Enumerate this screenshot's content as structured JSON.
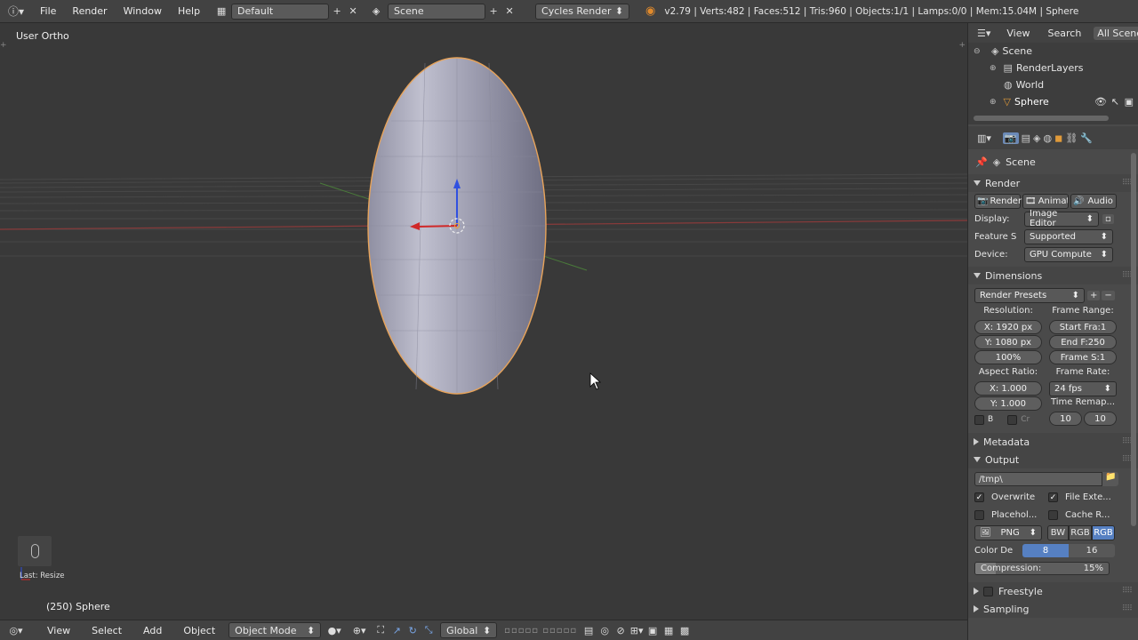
{
  "topbar": {
    "menus": [
      "File",
      "Render",
      "Window",
      "Help"
    ],
    "layout": "Default",
    "scene": "Scene",
    "engine": "Cycles Render",
    "stats": "v2.79 | Verts:482 | Faces:512 | Tris:960 | Objects:1/1 | Lamps:0/0 | Mem:15.04M | Sphere"
  },
  "viewport": {
    "view_label": "User Ortho",
    "last_op": "Last: Resize",
    "object_label": "(250) Sphere"
  },
  "outliner": {
    "view": "View",
    "search": "Search",
    "filter": "All Scenes",
    "items": [
      "Scene",
      "RenderLayers",
      "World",
      "Sphere"
    ]
  },
  "props": {
    "context": "Scene",
    "render": {
      "title": "Render",
      "tabs": [
        "Render",
        "Animati",
        "Audio"
      ],
      "display_label": "Display:",
      "display_value": "Image Editor",
      "feature_label": "Feature S",
      "feature_value": "Supported",
      "device_label": "Device:",
      "device_value": "GPU Compute"
    },
    "dimensions": {
      "title": "Dimensions",
      "presets": "Render Presets",
      "resolution_label": "Resolution:",
      "res_x": "X: 1920 px",
      "res_y": "Y: 1080 px",
      "res_pct": "100%",
      "frame_range_label": "Frame Range:",
      "start": "Start Fra:1",
      "end": "End F:250",
      "step": "Frame S:1",
      "aspect_label": "Aspect Ratio:",
      "asp_x": "X:    1.000",
      "asp_y": "Y:    1.000",
      "framerate_label": "Frame Rate:",
      "fps": "24 fps",
      "remap_label": "Time Remap...",
      "remap_old": "10",
      "remap_new": "10",
      "border": "B",
      "crop": "Cr"
    },
    "metadata": "Metadata",
    "output": {
      "title": "Output",
      "path": "/tmp\\",
      "overwrite": "Overwrite",
      "file_ext": "File Exte...",
      "placeholders": "Placehol...",
      "cache": "Cache R...",
      "format": "PNG",
      "bw": "BW",
      "rgb": "RGB",
      "rgba": "RGB",
      "color_depth_label": "Color De",
      "depth8": "8",
      "depth16": "16",
      "compression_label": "Compression:",
      "compression_value": "15%",
      "compression_fraction": 0.15
    },
    "freestyle": "Freestyle",
    "sampling": "Sampling"
  },
  "bottombar": {
    "menus": [
      "View",
      "Select",
      "Add",
      "Object"
    ],
    "mode": "Object Mode",
    "orientation": "Global"
  }
}
